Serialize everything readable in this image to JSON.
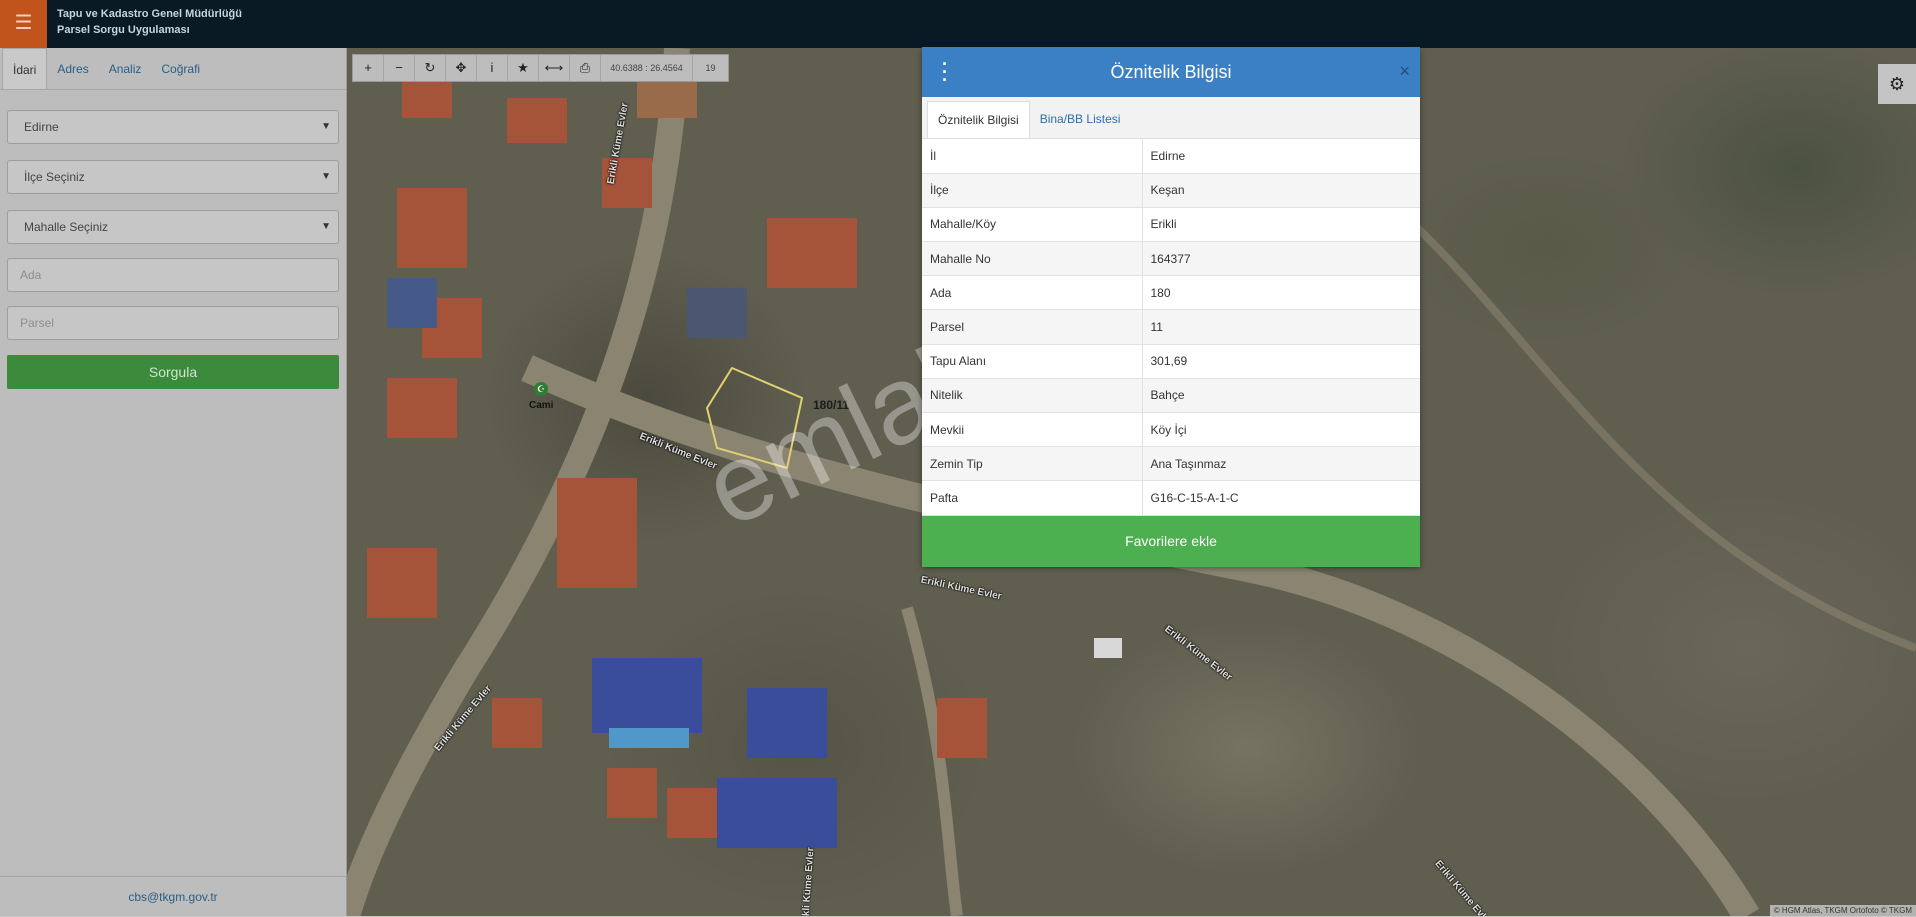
{
  "app": {
    "menu_icon": "hamburger-icon",
    "title_line1": "Tapu ve Kadastro Genel Müdürlüğü",
    "title_line2": "Parsel Sorgu Uygulaması"
  },
  "sidebar": {
    "tabs": [
      {
        "label": "İdari",
        "active": true
      },
      {
        "label": "Adres",
        "active": false
      },
      {
        "label": "Analiz",
        "active": false
      },
      {
        "label": "Coğrafi",
        "active": false
      }
    ],
    "il_value": "Edirne",
    "ilce_value": "İlçe Seçiniz",
    "mahalle_value": "Mahalle Seçiniz",
    "ada_placeholder": "Ada",
    "parsel_placeholder": "Parsel",
    "submit_label": "Sorgula",
    "footer_email": "cbs@tkgm.gov.tr"
  },
  "map": {
    "coordinates": "40.6388 : 26.4564",
    "zoom": "19",
    "parcel_label": "180/11",
    "poi_label": "Cami",
    "road_label": "Erikli Küme Evler",
    "attribution": "© HGM Atlas, TKGM Ortofoto © TKGM",
    "watermark": "emlakjet.com"
  },
  "popup": {
    "title": "Öznitelik Bilgisi",
    "close": "×",
    "tabs": [
      {
        "label": "Öznitelik Bilgisi",
        "active": true
      },
      {
        "label": "Bina/BB Listesi",
        "active": false
      }
    ],
    "rows": [
      {
        "key": "İl",
        "value": "Edirne"
      },
      {
        "key": "İlçe",
        "value": "Keşan"
      },
      {
        "key": "Mahalle/Köy",
        "value": "Erikli"
      },
      {
        "key": "Mahalle No",
        "value": "164377"
      },
      {
        "key": "Ada",
        "value": "180"
      },
      {
        "key": "Parsel",
        "value": "11"
      },
      {
        "key": "Tapu Alanı",
        "value": "301,69"
      },
      {
        "key": "Nitelik",
        "value": "Bahçe"
      },
      {
        "key": "Mevkii",
        "value": "Köy İçi"
      },
      {
        "key": "Zemin Tip",
        "value": "Ana Taşınmaz"
      },
      {
        "key": "Pafta",
        "value": "G16-C-15-A-1-C"
      }
    ],
    "favorite_button": "Favorilere ekle"
  }
}
